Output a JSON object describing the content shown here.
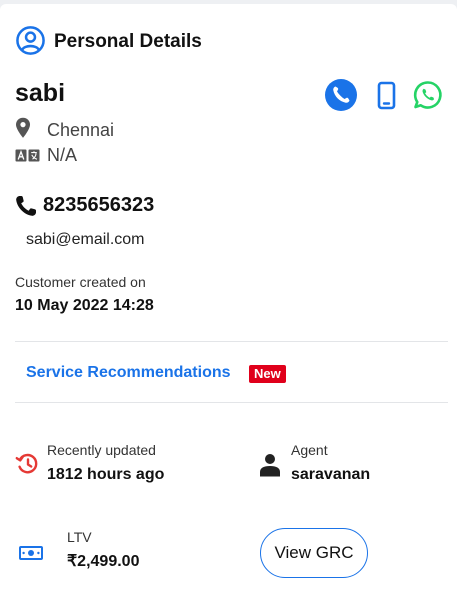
{
  "header": {
    "title": "Personal Details",
    "icon": "user-circle-icon",
    "accent_color": "#1a73e8"
  },
  "customer": {
    "name": "sabi",
    "location": "Chennai",
    "language": "N/A",
    "phone": "8235656323",
    "email": "sabi@email.com",
    "created_label": "Customer created on",
    "created_value": "10 May 2022 14:28"
  },
  "actions": [
    {
      "icon": "phone-call-icon",
      "color": "#1a73e8"
    },
    {
      "icon": "mobile-phone-icon",
      "color": "#1a73e8"
    },
    {
      "icon": "whatsapp-icon",
      "color": "#25d366"
    }
  ],
  "service": {
    "link_label": "Service Recommendations",
    "badge": "New",
    "link_color": "#1a73e8",
    "badge_color": "#e0001b"
  },
  "stats": {
    "updated_label": "Recently updated",
    "updated_value": "1812 hours ago",
    "agent_label": "Agent",
    "agent_value": "saravanan",
    "ltv_label": "LTV",
    "ltv_value": "₹2,499.00",
    "view_grc_label": "View GRC"
  }
}
